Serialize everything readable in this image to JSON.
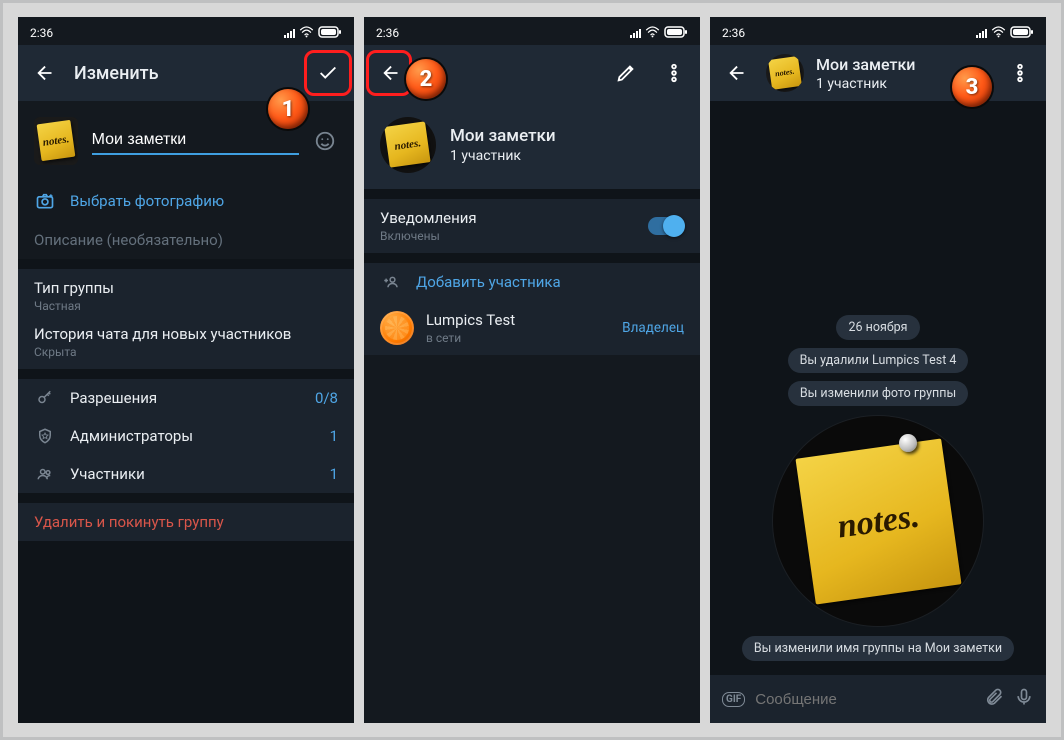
{
  "status": {
    "time": "2:36"
  },
  "screen1": {
    "title": "Изменить",
    "group_name": "Мои заметки",
    "choose_photo": "Выбрать фотографию",
    "description_placeholder": "Описание (необязательно)",
    "type_label": "Тип группы",
    "type_value": "Частная",
    "history_label": "История чата для новых участников",
    "history_value": "Скрыта",
    "permissions_label": "Разрешения",
    "permissions_value": "0/8",
    "admins_label": "Администраторы",
    "admins_value": "1",
    "members_label": "Участники",
    "members_value": "1",
    "delete_leave": "Удалить и покинуть группу",
    "marker": "1"
  },
  "screen2": {
    "group_name": "Мои заметки",
    "members_count": "1 участник",
    "notifications_label": "Уведомления",
    "notifications_state": "Включены",
    "add_member": "Добавить участника",
    "member_name": "Lumpics Test",
    "member_status": "в сети",
    "member_role": "Владелец",
    "marker": "2"
  },
  "screen3": {
    "group_name": "Мои заметки",
    "members_count": "1 участник",
    "date_chip": "26 ноября",
    "msg_removed": "Вы удалили Lumpics Test 4",
    "msg_photo": "Вы изменили фото группы",
    "msg_renamed": "Вы изменили имя группы на Мои заметки",
    "composer_placeholder": "Сообщение",
    "marker": "3",
    "sticker_text": "notes."
  }
}
